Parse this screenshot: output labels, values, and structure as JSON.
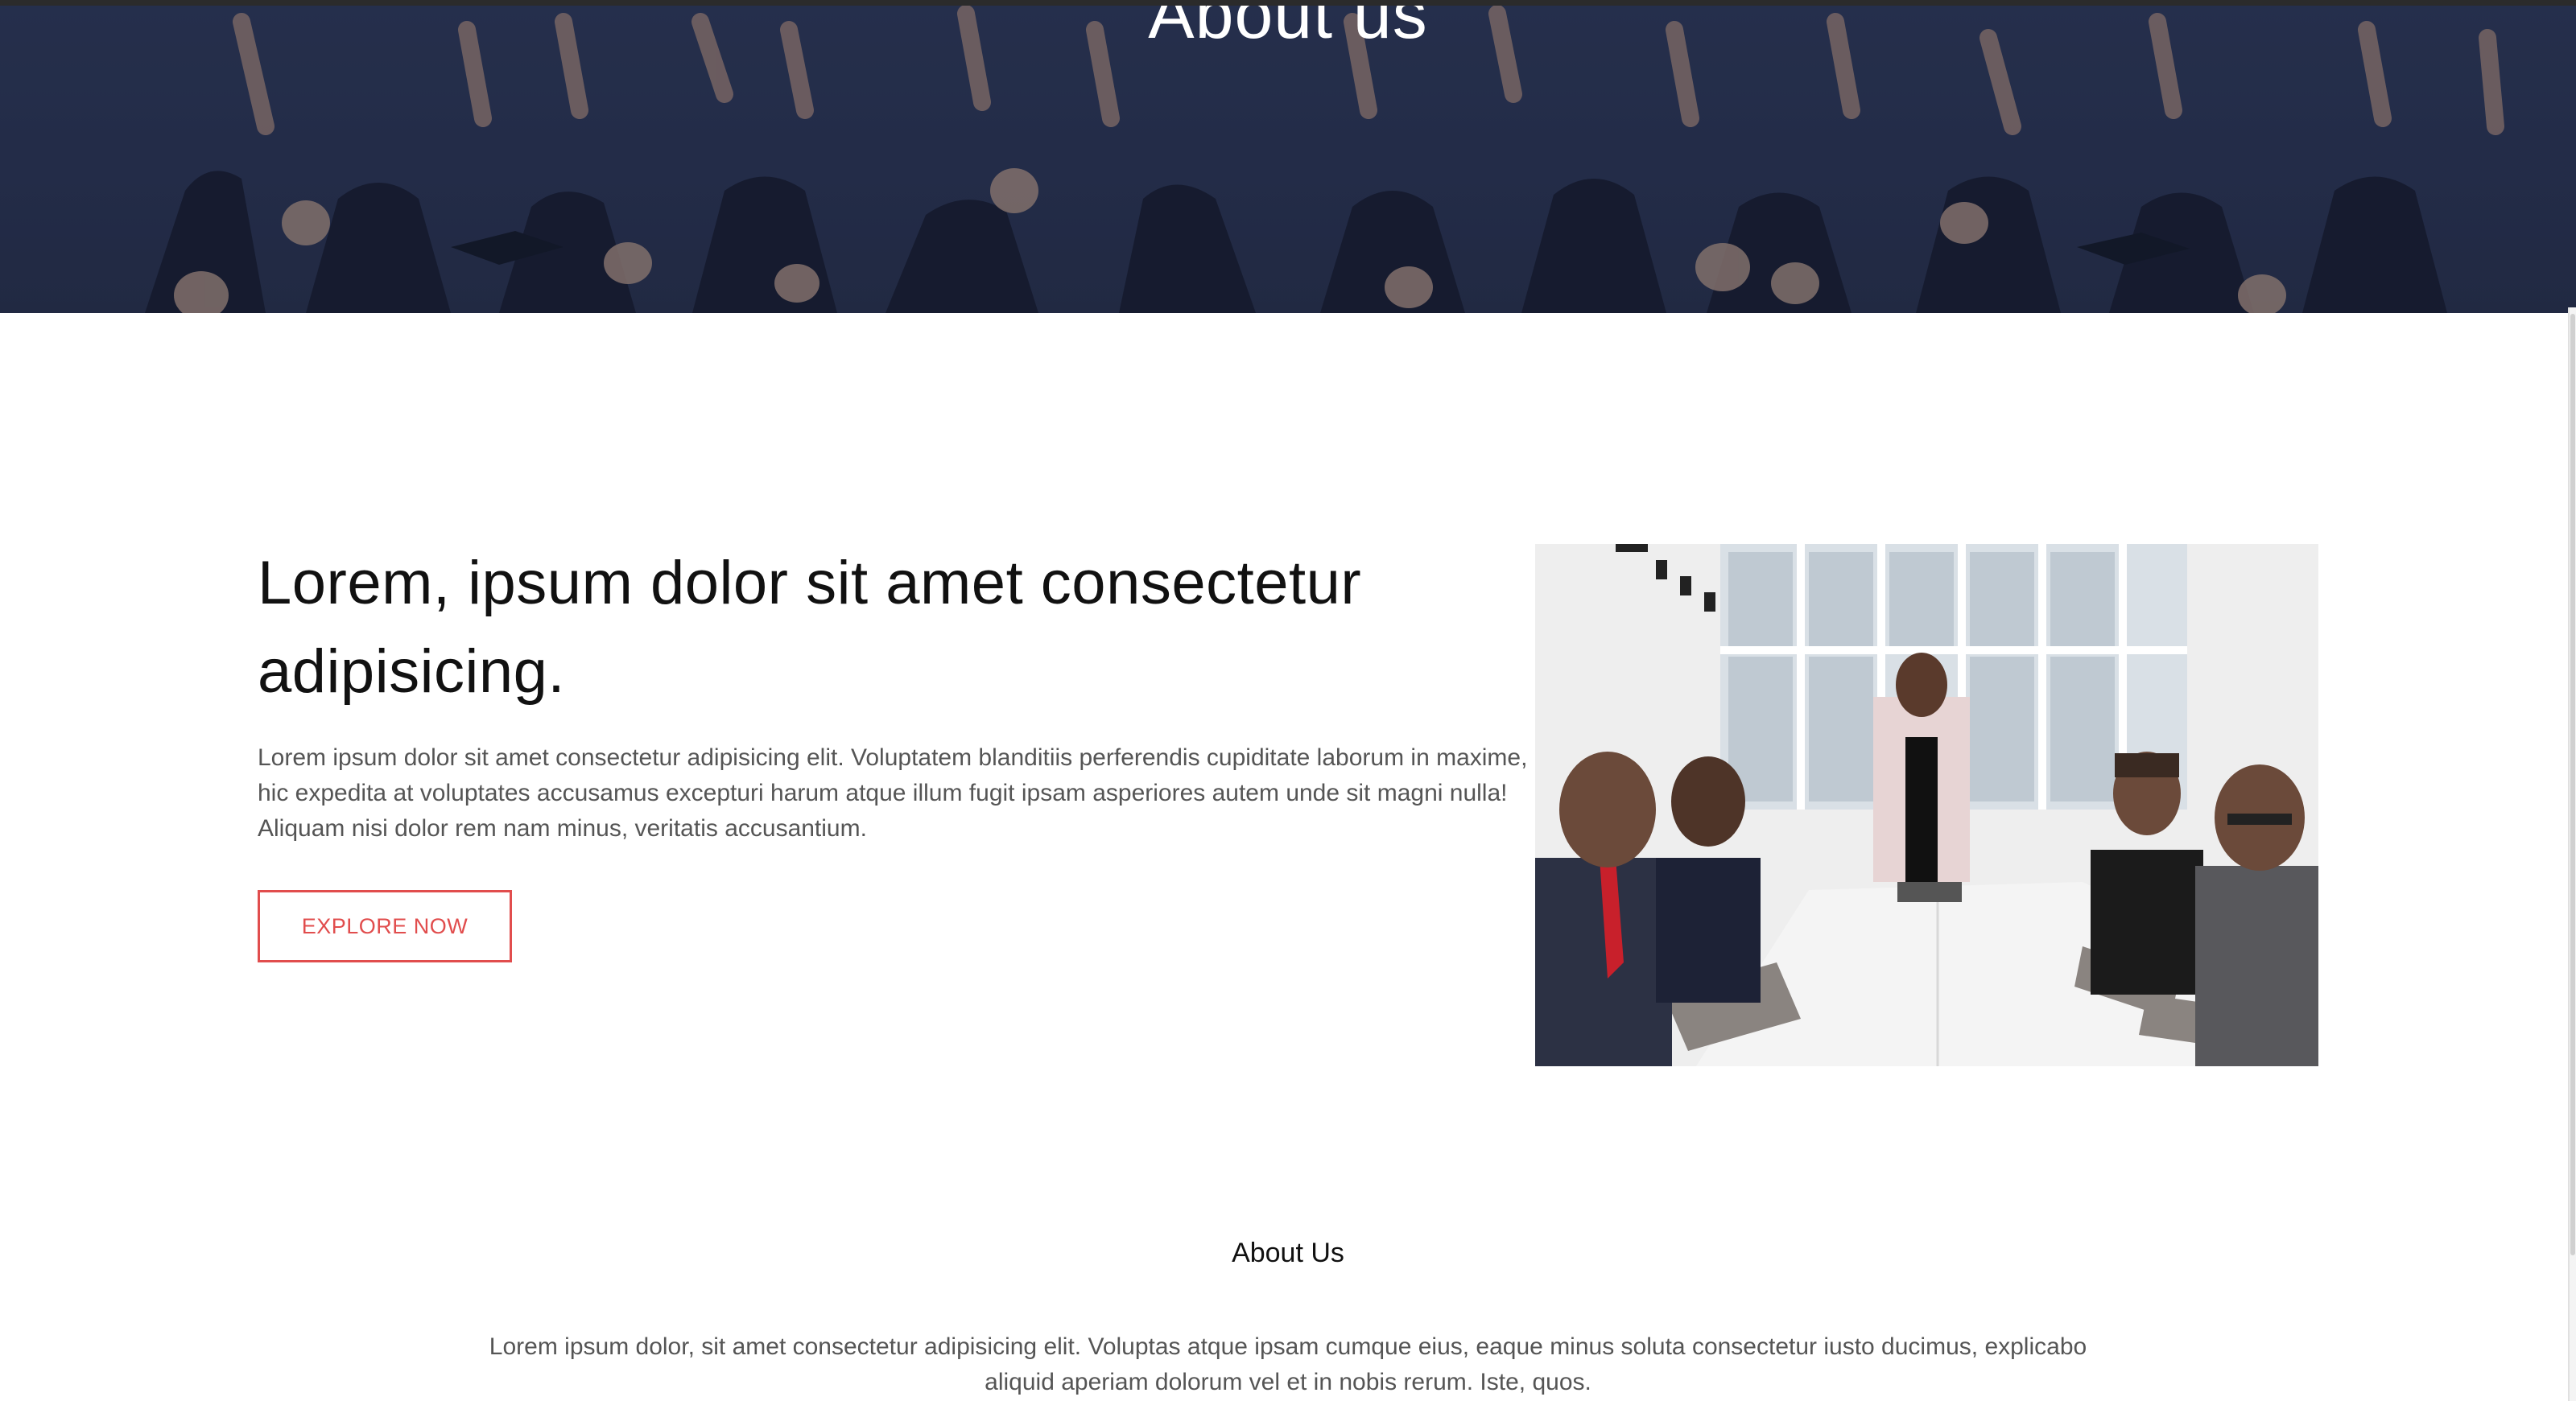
{
  "hero": {
    "title": "About us",
    "image_description": "graduates-throwing-caps-icon"
  },
  "intro": {
    "title": "Lorem, ipsum dolor sit amet consectetur adipisicing.",
    "text": "Lorem ipsum dolor sit amet consectetur adipisicing elit. Voluptatem blanditiis perferendis cupiditate laborum in maxime, hic expedita at voluptates accusamus excepturi harum atque illum fugit ipsam asperiores autem unde sit magni nulla! Aliquam nisi dolor rem nam minus, veritatis accusantium.",
    "button_label": "EXPLORE NOW",
    "image_icon": "business-meeting-photo-icon"
  },
  "about": {
    "heading": "About Us",
    "text": "Lorem ipsum dolor, sit amet consectetur adipisicing elit. Voluptas atque ipsam cumque eius, eaque minus soluta consectetur iusto ducimus, explicabo aliquid aperiam dolorum vel et in nobis rerum. Iste, quos."
  },
  "colors": {
    "accent": "#e14d4d",
    "hero_overlay": "#2a3552",
    "heading_text": "#111111",
    "body_text": "#555555"
  }
}
